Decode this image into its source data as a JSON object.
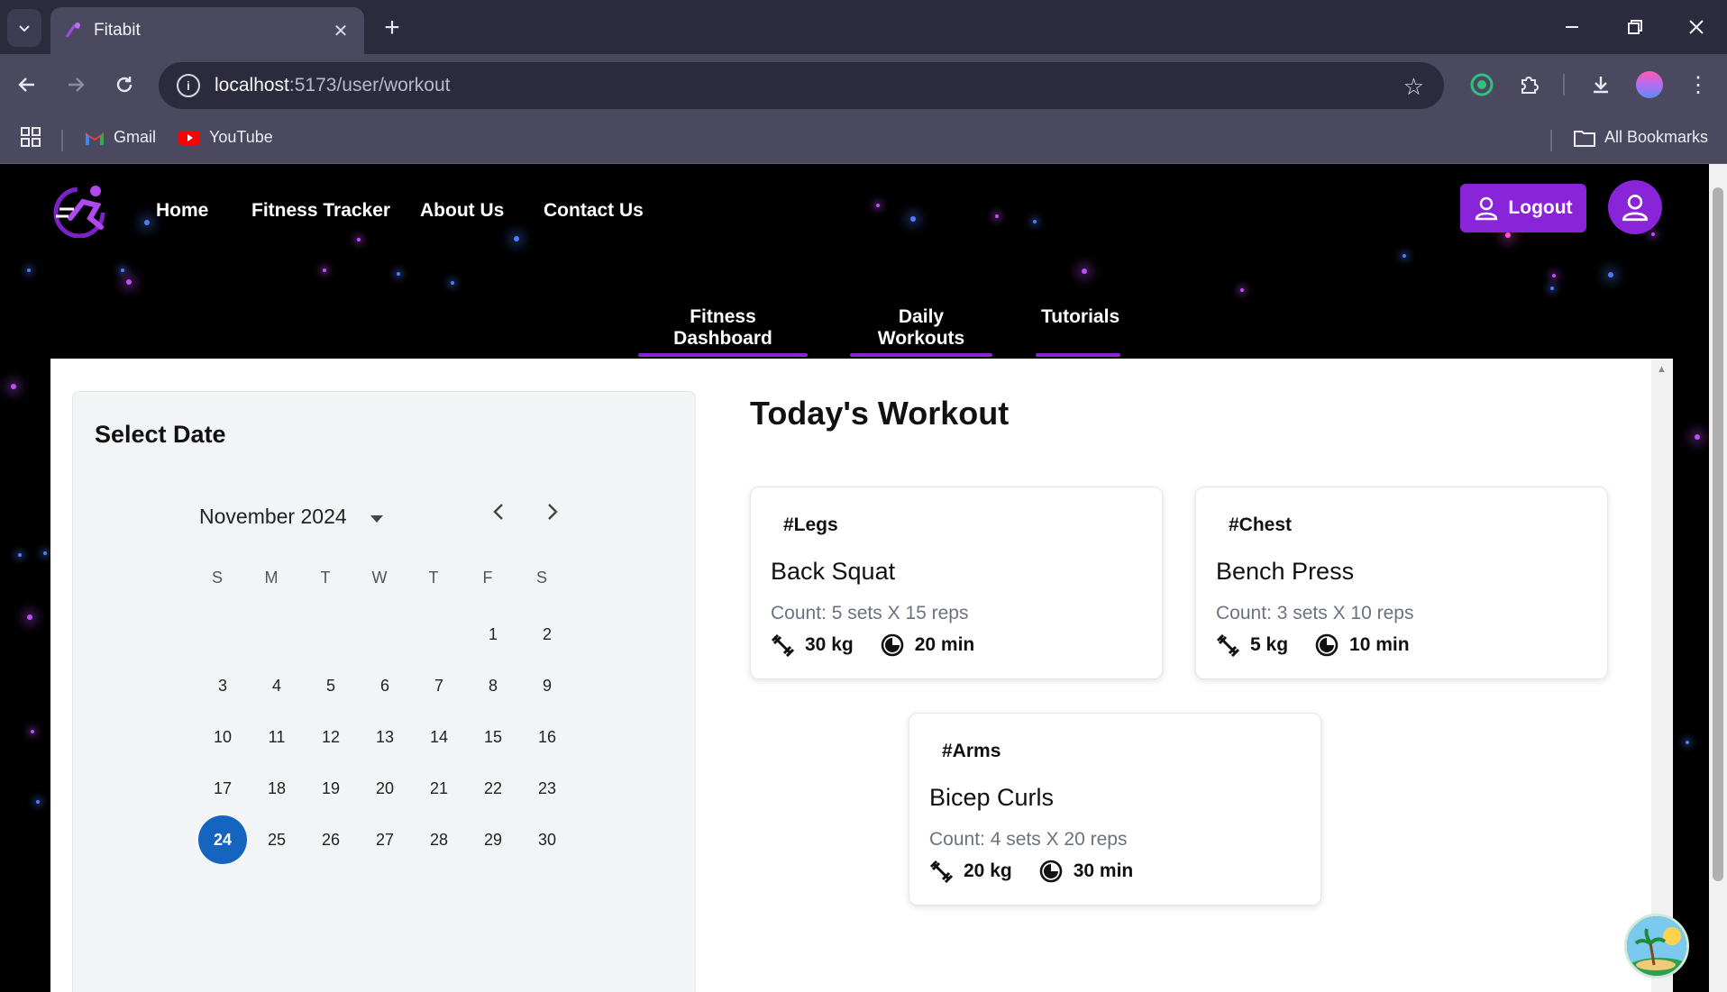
{
  "browser": {
    "tab_title": "Fitabit",
    "url_host": "localhost",
    "url_path": ":5173/user/workout",
    "bookmarks": [
      "Gmail",
      "YouTube"
    ],
    "all_bookmarks": "All Bookmarks"
  },
  "nav": {
    "links": [
      "Home",
      "Fitness Tracker",
      "About Us",
      "Contact Us"
    ],
    "logout": "Logout"
  },
  "subtabs": [
    "Fitness Dashboard",
    "Daily Workouts",
    "Tutorials"
  ],
  "calendar": {
    "title": "Select Date",
    "month_label": "November 2024",
    "weekdays": [
      "S",
      "M",
      "T",
      "W",
      "T",
      "F",
      "S"
    ],
    "selected_day": 24,
    "days": [
      "1",
      "2",
      "3",
      "4",
      "5",
      "6",
      "7",
      "8",
      "9",
      "10",
      "11",
      "12",
      "13",
      "14",
      "15",
      "16",
      "17",
      "18",
      "19",
      "20",
      "21",
      "22",
      "23",
      "24",
      "25",
      "26",
      "27",
      "28",
      "29",
      "30"
    ]
  },
  "workout": {
    "title": "Today's Workout",
    "cards": [
      {
        "tag": "#Legs",
        "name": "Back Squat",
        "count": "Count: 5 sets X 15 reps",
        "weight": "30 kg",
        "duration": "20 min"
      },
      {
        "tag": "#Chest",
        "name": "Bench Press",
        "count": "Count: 3 sets X 10 reps",
        "weight": "5 kg",
        "duration": "10 min"
      },
      {
        "tag": "#Arms",
        "name": "Bicep Curls",
        "count": "Count: 4 sets X 20 reps",
        "weight": "20 kg",
        "duration": "30 min"
      }
    ]
  },
  "colors": {
    "accent": "#8a24d9",
    "selected_day": "#1565c0",
    "chrome_dark": "#2c2b3d",
    "chrome": "#4a4960"
  }
}
